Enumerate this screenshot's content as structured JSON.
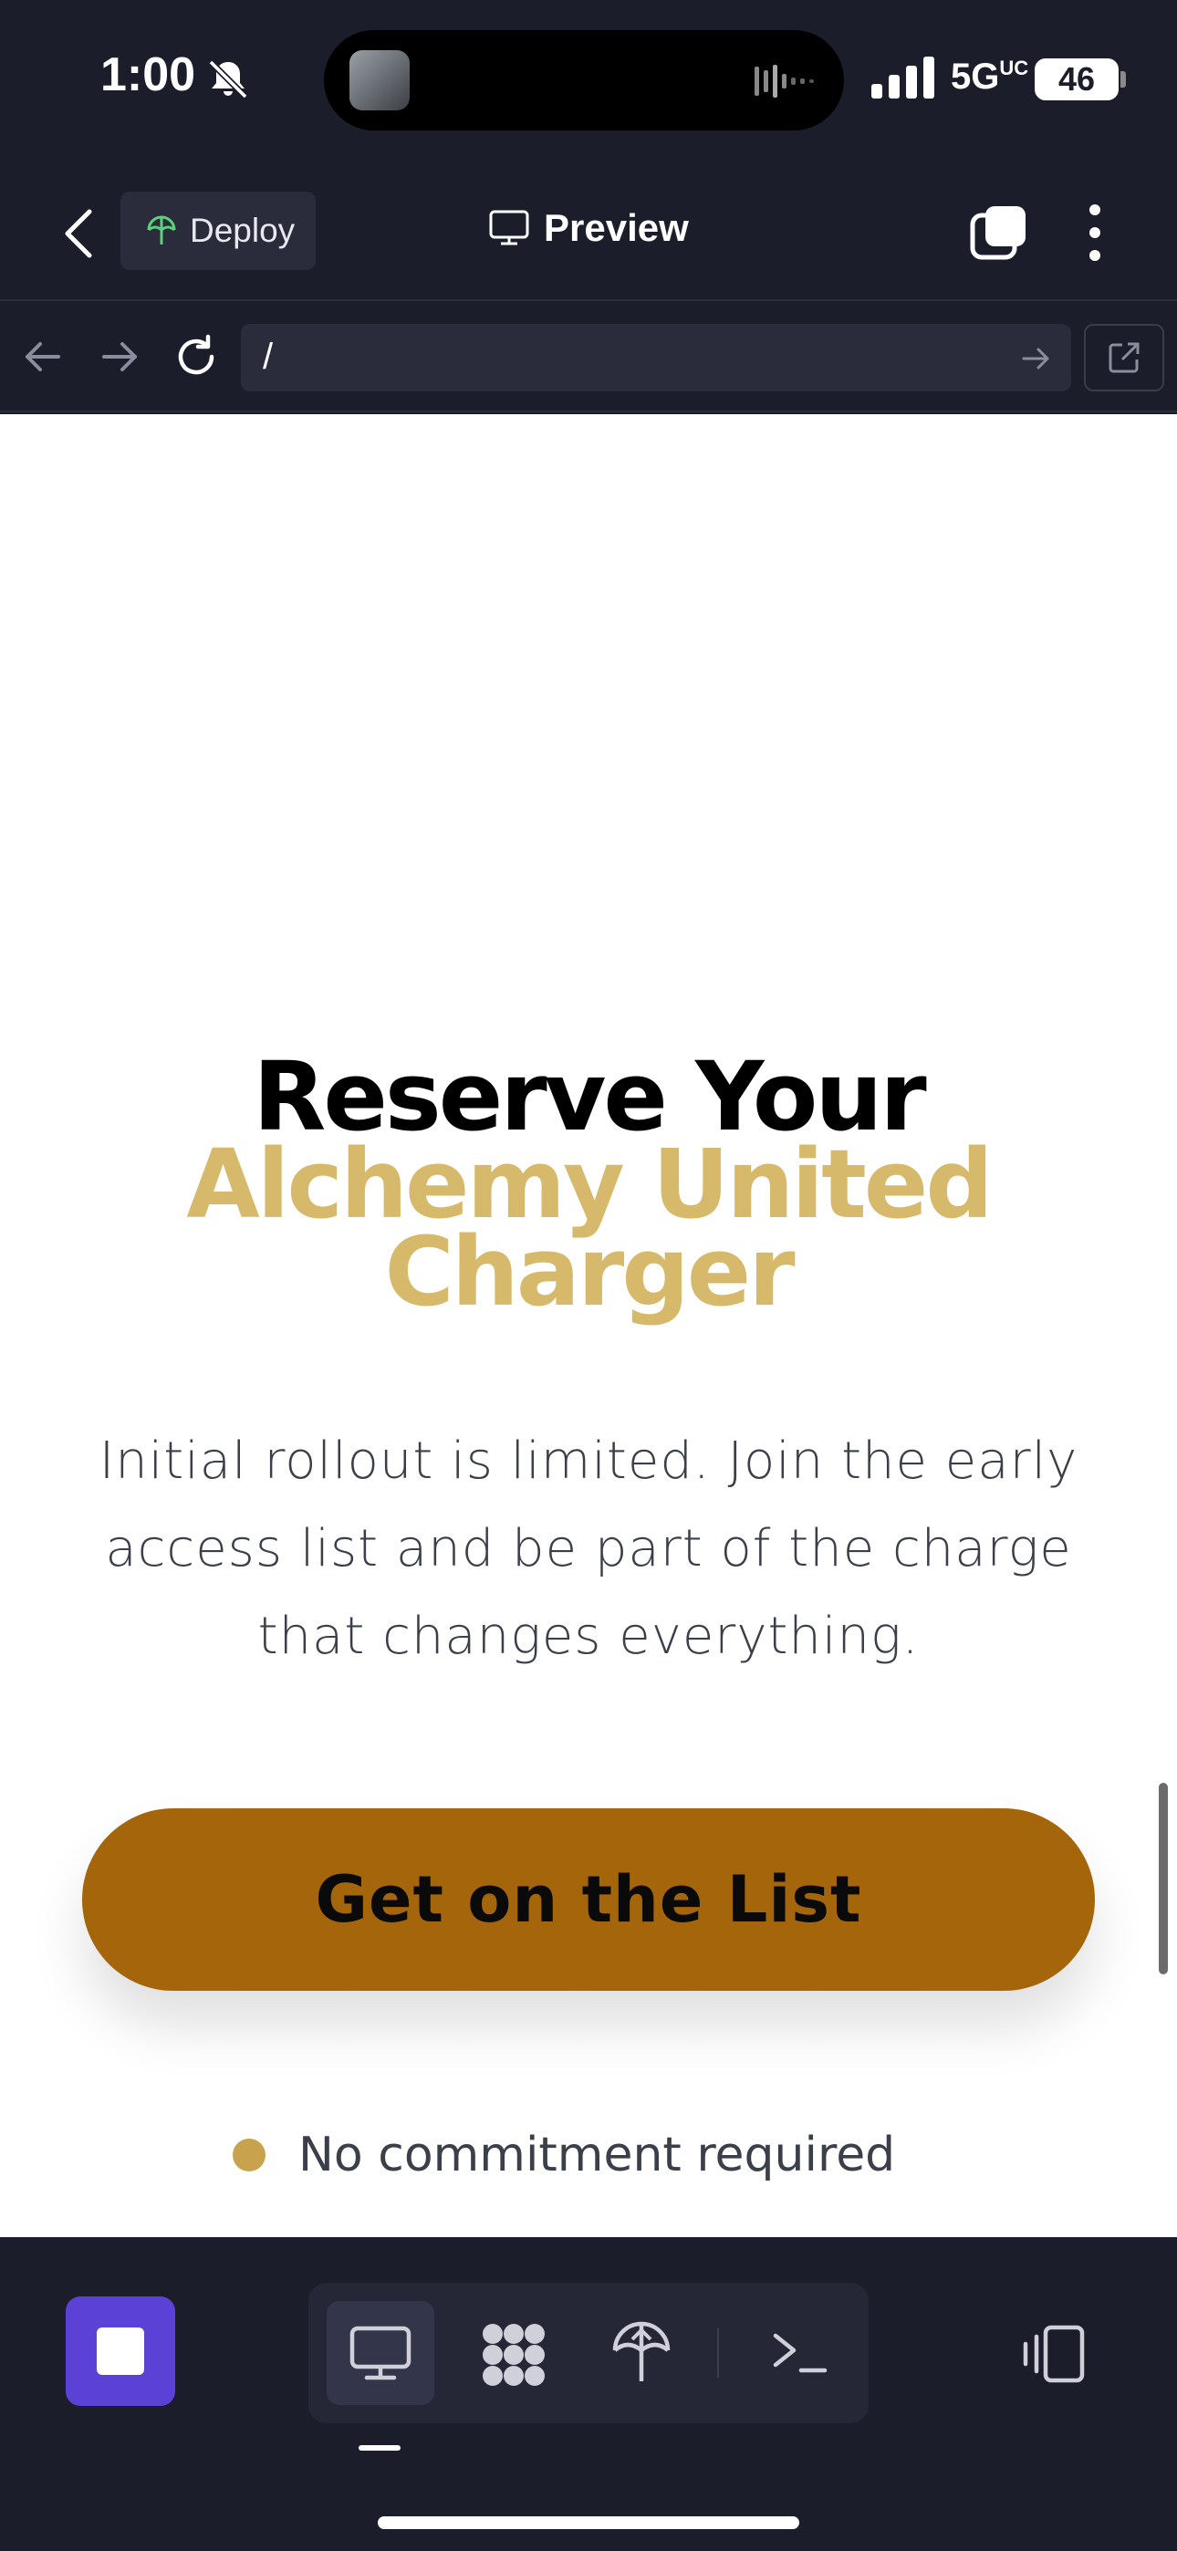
{
  "status_bar": {
    "time": "1:00",
    "network": "5G",
    "network_sup": "UC",
    "battery": "46"
  },
  "header": {
    "deploy_label": "Deploy",
    "title": "Preview"
  },
  "url_bar": {
    "url": "/"
  },
  "page": {
    "title_line1": "Reserve Your",
    "title_line2": "Alchemy United",
    "title_line3": "Charger",
    "subtitle": "Initial rollout is limited. Join the early access list and be part of the charge that changes everything.",
    "cta_label": "Get on the List",
    "note": "No commitment required"
  },
  "colors": {
    "accent_gold": "#d6b96a",
    "cta_bg": "#a5650b",
    "stop_button": "#5b41d6",
    "chrome_bg": "#1c1d2b"
  },
  "icons": {
    "toolbar": [
      "desktop-icon",
      "packages-icon",
      "deploy-icon",
      "terminal-icon"
    ],
    "rotate": "rotate-device-icon"
  }
}
